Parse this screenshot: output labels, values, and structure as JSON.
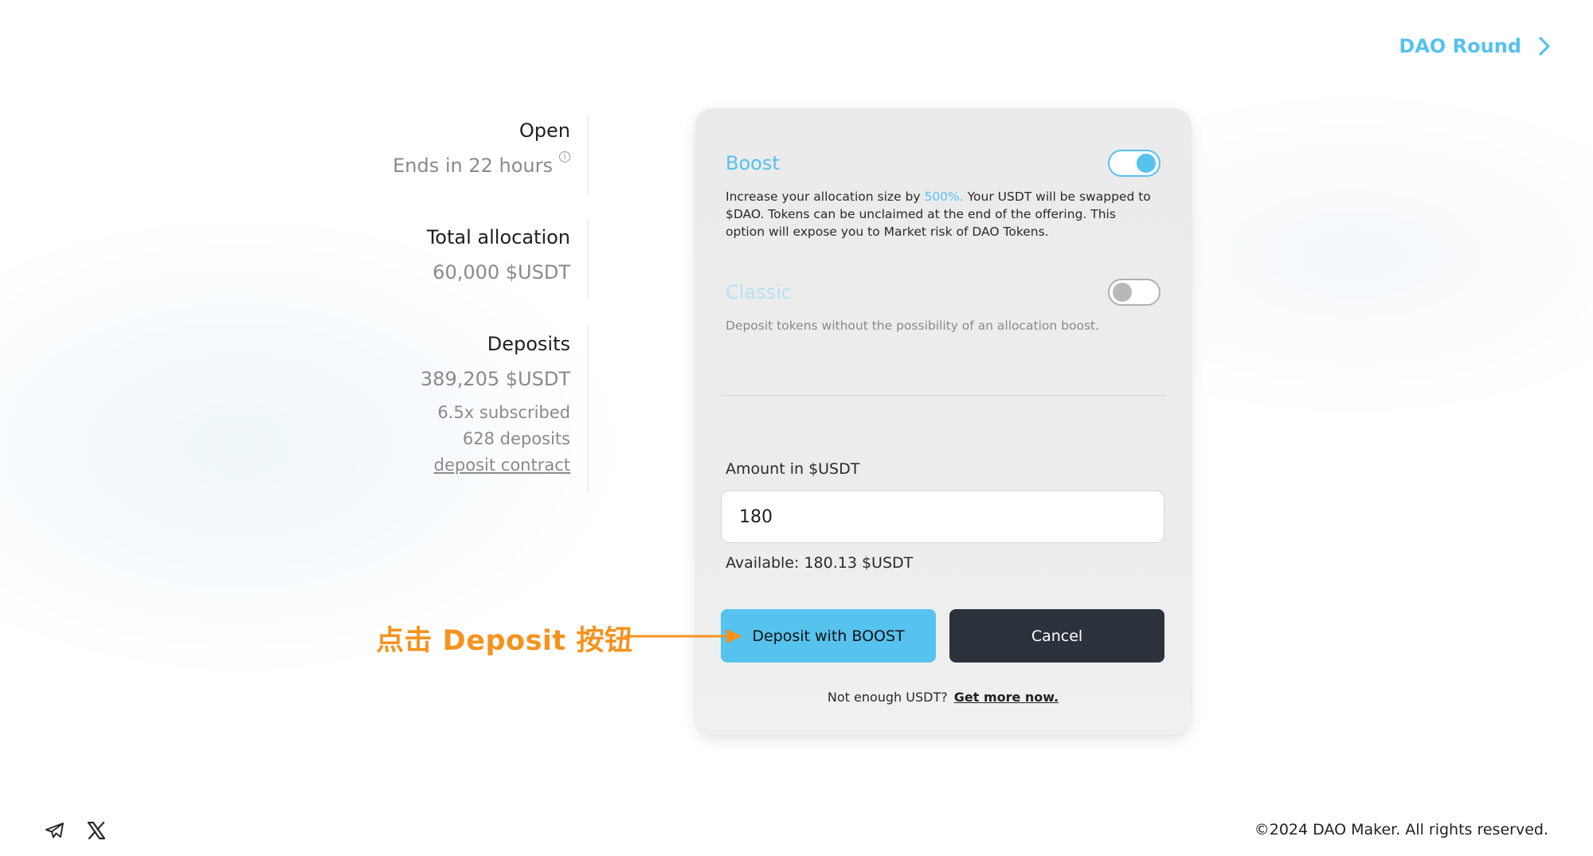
{
  "header": {
    "dao_round_label": "DAO Round",
    "dao_round_icon": "chevron-right-icon"
  },
  "stats": {
    "status": "Open",
    "ends_in": "Ends in 22 hours",
    "total_allocation_label": "Total allocation",
    "total_allocation_value": "60,000 $USDT",
    "deposits_label": "Deposits",
    "deposits_value": "389,205 $USDT",
    "subscribed": "6.5x subscribed",
    "deposit_count": "628 deposits",
    "deposit_contract_link": "deposit contract"
  },
  "card": {
    "boost": {
      "title": "Boost",
      "toggle_on": true,
      "desc_before": "Increase your allocation size by ",
      "desc_highlight": "500%.",
      "desc_after": " Your USDT will be swapped to $DAO. Tokens can be unclaimed at the end of the offering. This option will expose you to Market risk of DAO Tokens."
    },
    "classic": {
      "title": "Classic",
      "toggle_on": false,
      "desc": "Deposit tokens without the possibility of an allocation boost."
    },
    "amount_label": "Amount in $USDT",
    "amount_value": "180",
    "available": "Available: 180.13 $USDT",
    "deposit_button": "Deposit with BOOST",
    "cancel_button": "Cancel",
    "not_enough_text": "Not enough USDT?",
    "get_more_link": "Get more now."
  },
  "annotation": {
    "text": "点击 Deposit 按钮",
    "color": "#f5931e"
  },
  "footer": {
    "icons": [
      "telegram-icon",
      "x-twitter-icon"
    ],
    "copyright": "©2024 DAO Maker. All rights reserved."
  },
  "colors": {
    "accent": "#56c2ee",
    "dark_button": "#2b323c"
  }
}
